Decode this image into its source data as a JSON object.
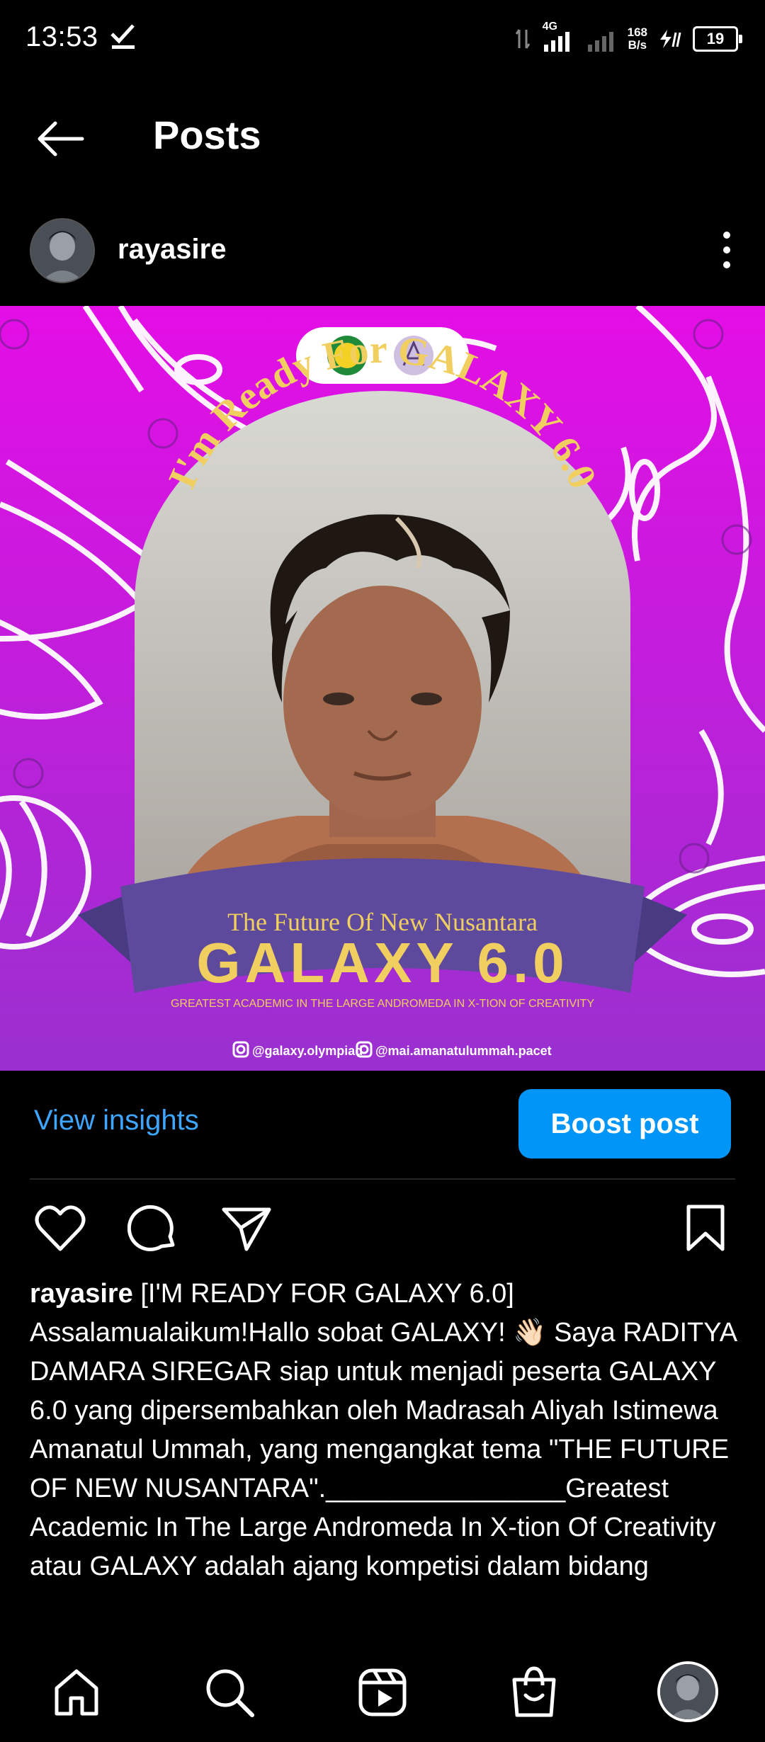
{
  "status_bar": {
    "time": "13:53",
    "network_type": "4G",
    "speed_value": "168",
    "speed_unit": "B/s",
    "battery": "19"
  },
  "header": {
    "title": "Posts"
  },
  "post": {
    "username": "rayasire",
    "image": {
      "headline": "I'm Ready For GALAXY 6.0",
      "banner_tagline": "The Future Of New Nusantara",
      "banner_title": "GALAXY 6.0",
      "banner_subtitle": "GREATEST ACADEMIC IN THE LARGE ANDROMEDA IN X-TION OF CREATIVITY",
      "handle_1": "@galaxy.olympiad",
      "handle_2": "@mai.amanatulummah.pacet"
    },
    "view_insights_label": "View insights",
    "boost_label": "Boost post",
    "caption_username": "rayasire",
    "caption_text": " [I'M READY FOR GALAXY 6.0] Assalamualaikum!Hallo sobat GALAXY! 👋🏻 Saya RADITYA DAMARA SIREGAR siap untuk menjadi peserta GALAXY 6.0 yang dipersembahkan oleh Madrasah Aliyah Istimewa Amanatul Ummah, yang mengangkat tema \"THE FUTURE OF NEW NUSANTARA\".________________Greatest Academic In The Large Andromeda In X-tion Of Creativity atau GALAXY adalah ajang kompetisi dalam bidang"
  },
  "icons": {
    "like": "heart-icon",
    "comment": "comment-icon",
    "share": "send-icon",
    "save": "bookmark-icon",
    "nav": [
      "home-icon",
      "search-icon",
      "reels-icon",
      "shop-icon",
      "profile-avatar"
    ]
  },
  "colors": {
    "accent": "#0095f6",
    "link": "#3ea6ff",
    "image_bg": "#d61ad9",
    "banner": "#5e4a9c",
    "gold": "#e8c45a"
  }
}
